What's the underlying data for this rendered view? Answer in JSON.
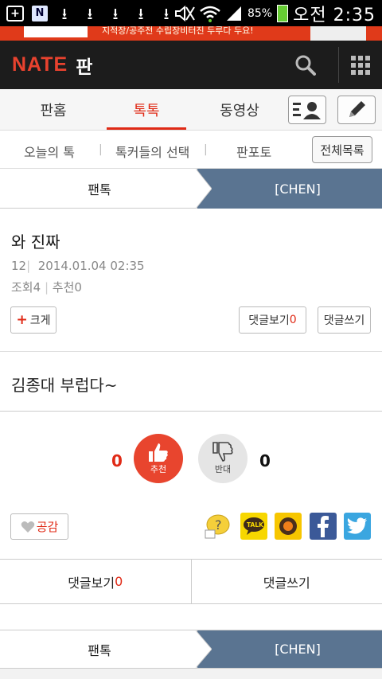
{
  "status_bar": {
    "n_badge": "N",
    "battery": "85%",
    "time": "오전 2:35"
  },
  "ad": {
    "text": "지적장/공주전 수립장비터진 두루다 두요!"
  },
  "header": {
    "logo": "NATE",
    "logo_sub": "판"
  },
  "tabs": [
    {
      "label": "판홈"
    },
    {
      "label": "톡톡"
    },
    {
      "label": "동영상"
    }
  ],
  "subnav": {
    "items": [
      "오늘의 톡",
      "톡커들의 선택",
      "판포토"
    ],
    "all_button": "전체목록"
  },
  "breadcrumb": {
    "left": "팬톡",
    "right": "[CHEN]"
  },
  "post": {
    "title": "와 진짜",
    "number": "12",
    "datetime": "2014.01.04 02:35",
    "views_label": "조회",
    "views": "4",
    "recommend_label": "추천",
    "recommend": "0",
    "enlarge_plus": "+",
    "enlarge_label": "크게",
    "view_comments_label": "댓글보기",
    "view_comments_count": "0",
    "write_comment_label": "댓글쓰기",
    "body": "김종대 부럽다~"
  },
  "vote": {
    "up_count": "0",
    "up_label": "추천",
    "down_label": "반대",
    "down_count": "0"
  },
  "share": {
    "empathy_label": "공감",
    "kakao_talk": "TALK"
  },
  "comment_bar": {
    "view_label": "댓글보기",
    "view_count": "0",
    "write_label": "댓글쓰기"
  },
  "footer_breadcrumb": {
    "left": "팬톡",
    "right": "[CHEN]"
  },
  "colors": {
    "accent": "#e02a16",
    "breadcrumb_blue": "#5a7491",
    "recommend": "#e8452e",
    "oppose": "#e5e5e5"
  }
}
